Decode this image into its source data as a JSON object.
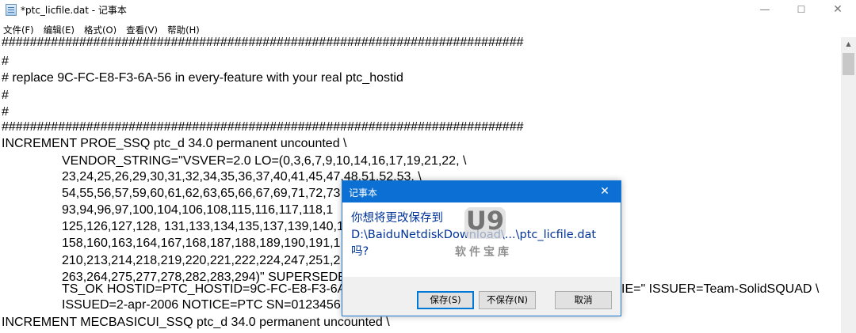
{
  "window": {
    "title": "*ptc_licfile.dat - 记事本",
    "minimize_glyph": "—",
    "maximize_glyph": "☐",
    "close_glyph": "✕",
    "icon": "notepad-icon"
  },
  "menu": {
    "items": [
      "文件(F)",
      "编辑(E)",
      "格式(O)",
      "查看(V)",
      "帮助(H)"
    ]
  },
  "editor": {
    "lines": [
      "##########################################################################",
      "#",
      "# replace 9C-FC-E8-F3-6A-56 in every-feature with your real ptc_hostid",
      "#",
      "#",
      "##########################################################################",
      "INCREMENT PROE_SSQ ptc_d 34.0 permanent uncounted \\",
      "VENDOR_STRING=\"VSVER=2.0 LO=(0,3,6,7,9,10,14,16,17,19,21,22, \\",
      "23,24,25,26,29,30,31,32,34,35,36,37,40,41,45,47,48,51,52,53, \\",
      "54,55,56,57,59,60,61,62,63,65,66,67,69,71,72,73",
      "93,94,96,97,100,104,106,108,115,116,117,118,1",
      "125,126,127,128, 131,133,134,135,137,139,140,1",
      "158,160,163,164,167,168,187,188,189,190,191,1",
      "210,213,214,218,219,220,221,222,224,247,251,2",
      "263,264,275,277,278,282,283,294)\" SUPERSEDE",
      "TS_OK HOSTID=PTC_HOSTID=9C-FC-E8-F3-6A",
      "ISSUED=2-apr-2006 NOTICE=PTC SN=0123456",
      "INCREMENT MECBASICUI_SSQ ptc_d 34.0 permanent uncounted \\"
    ],
    "partial_right": {
      "line16": "IE=\" ISSUER=Team-SolidSQUAD \\"
    }
  },
  "scrollbar": {
    "up_arrow": "▲"
  },
  "watermark": {
    "badge": "U9",
    "subtitle": "软件宝库"
  },
  "dialog": {
    "title": "记事本",
    "close_glyph": "✕",
    "message_lines": [
      "你想将更改保存到",
      "D:\\BaiduNetdiskDownload\\...\\ptc_licfile.dat",
      "吗?"
    ],
    "buttons": {
      "save": "保存(S)",
      "dont_save": "不保存(N)",
      "cancel": "取消"
    }
  }
}
